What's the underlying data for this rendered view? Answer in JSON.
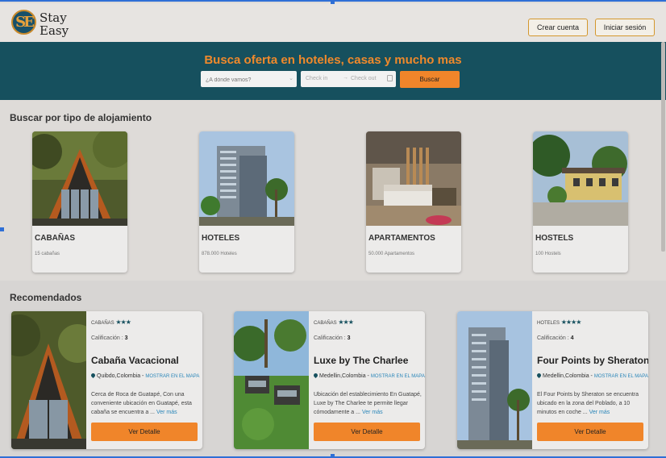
{
  "brand": {
    "logo_mark": "SE",
    "line1": "Stay",
    "line2": "Easy"
  },
  "header": {
    "signup_label": "Crear cuenta",
    "login_label": "Iniciar sesión"
  },
  "hero": {
    "title": "Busca oferta en hoteles, casas y mucho mas",
    "destination_placeholder": "¿A dónde vamos?",
    "checkin_placeholder": "Check in",
    "checkout_placeholder": "Check out",
    "search_label": "Buscar"
  },
  "types": {
    "title": "Buscar por tipo de alojamiento",
    "items": [
      {
        "name": "CABAÑAS",
        "count": "15 cabañas"
      },
      {
        "name": "HOTELES",
        "count": "878.000 Hoteles"
      },
      {
        "name": "APARTAMENTOS",
        "count": "50.000 Apartamentos"
      },
      {
        "name": "HOSTELS",
        "count": "100 Hostels"
      }
    ]
  },
  "recommended": {
    "title": "Recomendados",
    "rating_label": "Calificación :",
    "map_label": "MOSTRAR EN EL MAPA",
    "more_label": "Ver más",
    "detail_label": "Ver Detalle",
    "items": [
      {
        "type": "CABAÑAS",
        "stars": "★★★",
        "rating": "3",
        "name": "Cabaña Vacacional",
        "location": "Quibdo,Colombia",
        "description": "Cerca de Roca de Guatapé, Con una conveniente ubicación en Guatapé, esta cabaña se encuentra a ..."
      },
      {
        "type": "CABAÑAS",
        "stars": "★★★",
        "rating": "3",
        "name": "Luxe by The Charlee",
        "location": "Medellin,Colombia",
        "description": "Ubicación del establecimiento En Guatapé, Luxe by The Charlee te permite llegar cómodamente a ..."
      },
      {
        "type": "HOTELES",
        "stars": "★★★★",
        "rating": "4",
        "name": "Four Points by Sheraton",
        "location": "Medellin,Colombia",
        "description": "El Four Points by Sheraton se encuentra ubicado en la zona del Poblado, a 10 minutos en coche ..."
      }
    ]
  },
  "colors": {
    "primary": "#16505e",
    "accent": "#f0852a",
    "link": "#2a86b9"
  },
  "icons": {
    "destination_chevron": "chevron-down-icon",
    "dates_arrow": "arrow-right-icon",
    "calendar": "calendar-icon",
    "location": "map-pin-icon",
    "stars": "star-icon"
  }
}
